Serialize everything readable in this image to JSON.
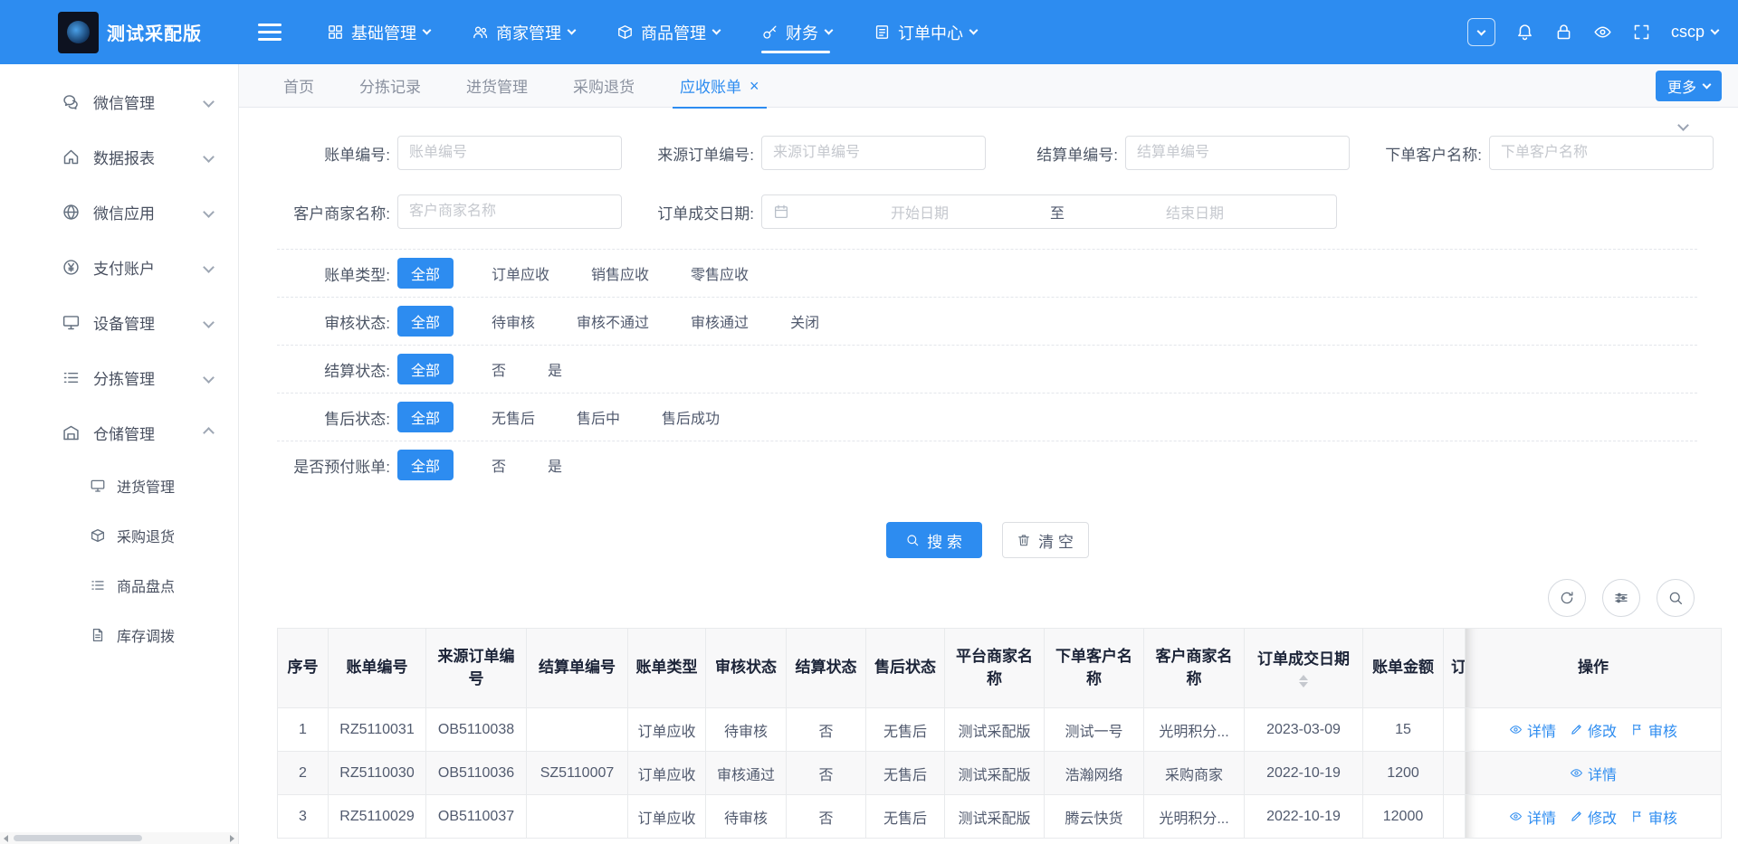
{
  "app": {
    "logo_text": "测试采配版",
    "user": "cscp"
  },
  "icons": {
    "tab_close": "×"
  },
  "header_nav": [
    {
      "label": "基础管理"
    },
    {
      "label": "商家管理"
    },
    {
      "label": "商品管理"
    },
    {
      "label": "财务"
    },
    {
      "label": "订单中心"
    }
  ],
  "sidebar": {
    "menus": [
      {
        "label": "微信管理"
      },
      {
        "label": "数据报表"
      },
      {
        "label": "微信应用"
      },
      {
        "label": "支付账户"
      },
      {
        "label": "设备管理"
      },
      {
        "label": "分拣管理"
      },
      {
        "label": "仓储管理"
      }
    ],
    "submenus": [
      {
        "label": "进货管理"
      },
      {
        "label": "采购退货"
      },
      {
        "label": "商品盘点"
      },
      {
        "label": "库存调拨"
      }
    ]
  },
  "tabs": {
    "items": [
      {
        "label": "首页"
      },
      {
        "label": "分拣记录"
      },
      {
        "label": "进货管理"
      },
      {
        "label": "采购退货"
      },
      {
        "label": "应收账单"
      }
    ],
    "more": "更多"
  },
  "filter": {
    "fields": [
      {
        "label": "账单编号:",
        "placeholder": "账单编号"
      },
      {
        "label": "来源订单编号:",
        "placeholder": "来源订单编号"
      },
      {
        "label": "结算单编号:",
        "placeholder": "结算单编号"
      },
      {
        "label": "下单客户名称:",
        "placeholder": "下单客户名称"
      },
      {
        "label": "客户商家名称:",
        "placeholder": "客户商家名称"
      }
    ],
    "date": {
      "label": "订单成交日期:",
      "start": "开始日期",
      "to": "至",
      "end": "结束日期"
    },
    "groups": [
      {
        "label": "账单类型:",
        "all": "全部",
        "options": [
          "订单应收",
          "销售应收",
          "零售应收"
        ]
      },
      {
        "label": "审核状态:",
        "all": "全部",
        "options": [
          "待审核",
          "审核不通过",
          "审核通过",
          "关闭"
        ]
      },
      {
        "label": "结算状态:",
        "all": "全部",
        "options": [
          "否",
          "是"
        ]
      },
      {
        "label": "售后状态:",
        "all": "全部",
        "options": [
          "无售后",
          "售后中",
          "售后成功"
        ]
      },
      {
        "label": "是否预付账单:",
        "all": "全部",
        "options": [
          "否",
          "是"
        ]
      }
    ],
    "search_button": "搜 索",
    "clear_button": "清 空"
  },
  "table": {
    "columns": [
      "序号",
      "账单编号",
      "来源订单编号",
      "结算单编号",
      "账单类型",
      "审核状态",
      "结算状态",
      "售后状态",
      "平台商家名称",
      "下单客户名称",
      "客户商家名称",
      "订单成交日期",
      "账单金额",
      "订",
      "操作"
    ],
    "rows": [
      {
        "cells": [
          "1",
          "RZ5110031",
          "OB5110038",
          "",
          "订单应收",
          "待审核",
          "否",
          "无售后",
          "测试采配版",
          "测试一号",
          "光明积分...",
          "2023-03-09",
          "15"
        ],
        "actions": [
          "详情",
          "修改",
          "审核"
        ]
      },
      {
        "cells": [
          "2",
          "RZ5110030",
          "OB5110036",
          "SZ5110007",
          "订单应收",
          "审核通过",
          "否",
          "无售后",
          "测试采配版",
          "浩瀚网络",
          "采购商家",
          "2022-10-19",
          "1200"
        ],
        "actions": [
          "详情"
        ]
      },
      {
        "cells": [
          "3",
          "RZ5110029",
          "OB5110037",
          "",
          "订单应收",
          "待审核",
          "否",
          "无售后",
          "测试采配版",
          "腾云快货",
          "光明积分...",
          "2022-10-19",
          "12000"
        ],
        "actions": [
          "详情",
          "修改",
          "审核"
        ]
      }
    ]
  },
  "colors": {
    "primary": "#2d8cf0"
  }
}
